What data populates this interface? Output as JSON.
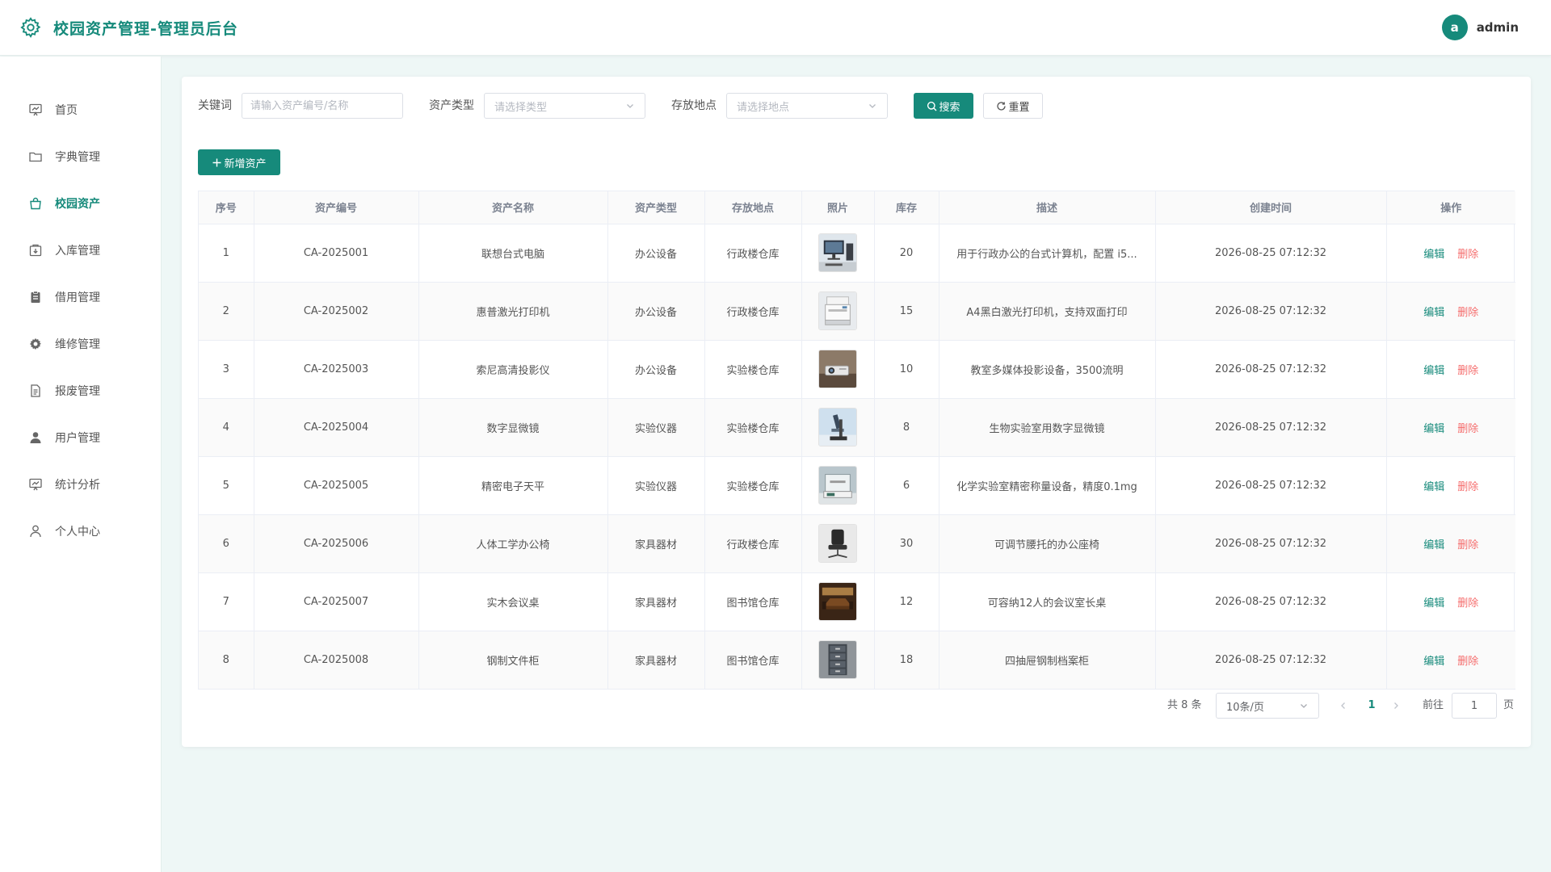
{
  "app": {
    "title": "校园资产管理-管理员后台",
    "accent": "#168a7b",
    "danger": "#f56c6c",
    "brand_icon": "gear-icon"
  },
  "user": {
    "avatar_letter": "a",
    "name": "admin"
  },
  "sidebar": {
    "items": [
      {
        "label": "首页",
        "icon": "chart-board-icon"
      },
      {
        "label": "字典管理",
        "icon": "folder-icon"
      },
      {
        "label": "校园资产",
        "icon": "bag-icon",
        "active": true
      },
      {
        "label": "入库管理",
        "icon": "inbox-icon"
      },
      {
        "label": "借用管理",
        "icon": "clipboard-icon"
      },
      {
        "label": "维修管理",
        "icon": "gear-icon"
      },
      {
        "label": "报废管理",
        "icon": "document-icon"
      },
      {
        "label": "用户管理",
        "icon": "user-filled-icon"
      },
      {
        "label": "统计分析",
        "icon": "chart-board-icon"
      },
      {
        "label": "个人中心",
        "icon": "user-icon"
      }
    ]
  },
  "filters": {
    "keyword_label": "关键词",
    "keyword_placeholder": "请输入资产编号/名称",
    "keyword_value": "",
    "type_label": "资产类型",
    "type_placeholder": "请选择类型",
    "location_label": "存放地点",
    "location_placeholder": "请选择地点",
    "search_label": "搜索",
    "reset_label": "重置"
  },
  "actions": {
    "add_label": "新增资产"
  },
  "table": {
    "columns": [
      "序号",
      "资产编号",
      "资产名称",
      "资产类型",
      "存放地点",
      "照片",
      "库存",
      "描述",
      "创建时间",
      "操作"
    ],
    "edit_label": "编辑",
    "delete_label": "删除",
    "rows": [
      {
        "index": "1",
        "code": "CA-2025001",
        "name": "联想台式电脑",
        "type": "办公设备",
        "location": "行政楼仓库",
        "stock": "20",
        "desc": "用于行政办公的台式计算机，配置 i5...",
        "created": "2026-08-25 07:12:32",
        "photo": "desktop-computer"
      },
      {
        "index": "2",
        "code": "CA-2025002",
        "name": "惠普激光打印机",
        "type": "办公设备",
        "location": "行政楼仓库",
        "stock": "15",
        "desc": "A4黑白激光打印机，支持双面打印",
        "created": "2026-08-25 07:12:32",
        "photo": "printer"
      },
      {
        "index": "3",
        "code": "CA-2025003",
        "name": "索尼高清投影仪",
        "type": "办公设备",
        "location": "实验楼仓库",
        "stock": "10",
        "desc": "教室多媒体投影设备，3500流明",
        "created": "2026-08-25 07:12:32",
        "photo": "projector"
      },
      {
        "index": "4",
        "code": "CA-2025004",
        "name": "数字显微镜",
        "type": "实验仪器",
        "location": "实验楼仓库",
        "stock": "8",
        "desc": "生物实验室用数字显微镜",
        "created": "2026-08-25 07:12:32",
        "photo": "microscope"
      },
      {
        "index": "5",
        "code": "CA-2025005",
        "name": "精密电子天平",
        "type": "实验仪器",
        "location": "实验楼仓库",
        "stock": "6",
        "desc": "化学实验室精密称量设备，精度0.1mg",
        "created": "2026-08-25 07:12:32",
        "photo": "balance"
      },
      {
        "index": "6",
        "code": "CA-2025006",
        "name": "人体工学办公椅",
        "type": "家具器材",
        "location": "行政楼仓库",
        "stock": "30",
        "desc": "可调节腰托的办公座椅",
        "created": "2026-08-25 07:12:32",
        "photo": "office-chair"
      },
      {
        "index": "7",
        "code": "CA-2025007",
        "name": "实木会议桌",
        "type": "家具器材",
        "location": "图书馆仓库",
        "stock": "12",
        "desc": "可容纳12人的会议室长桌",
        "created": "2026-08-25 07:12:32",
        "photo": "meeting-table"
      },
      {
        "index": "8",
        "code": "CA-2025008",
        "name": "钢制文件柜",
        "type": "家具器材",
        "location": "图书馆仓库",
        "stock": "18",
        "desc": "四抽屉钢制档案柜",
        "created": "2026-08-25 07:12:32",
        "photo": "file-cabinet"
      }
    ]
  },
  "pagination": {
    "total_text": "共 8 条",
    "page_size": "10条/页",
    "current_page": "1",
    "goto_label": "前往",
    "goto_value": "1",
    "page_unit": "页"
  }
}
